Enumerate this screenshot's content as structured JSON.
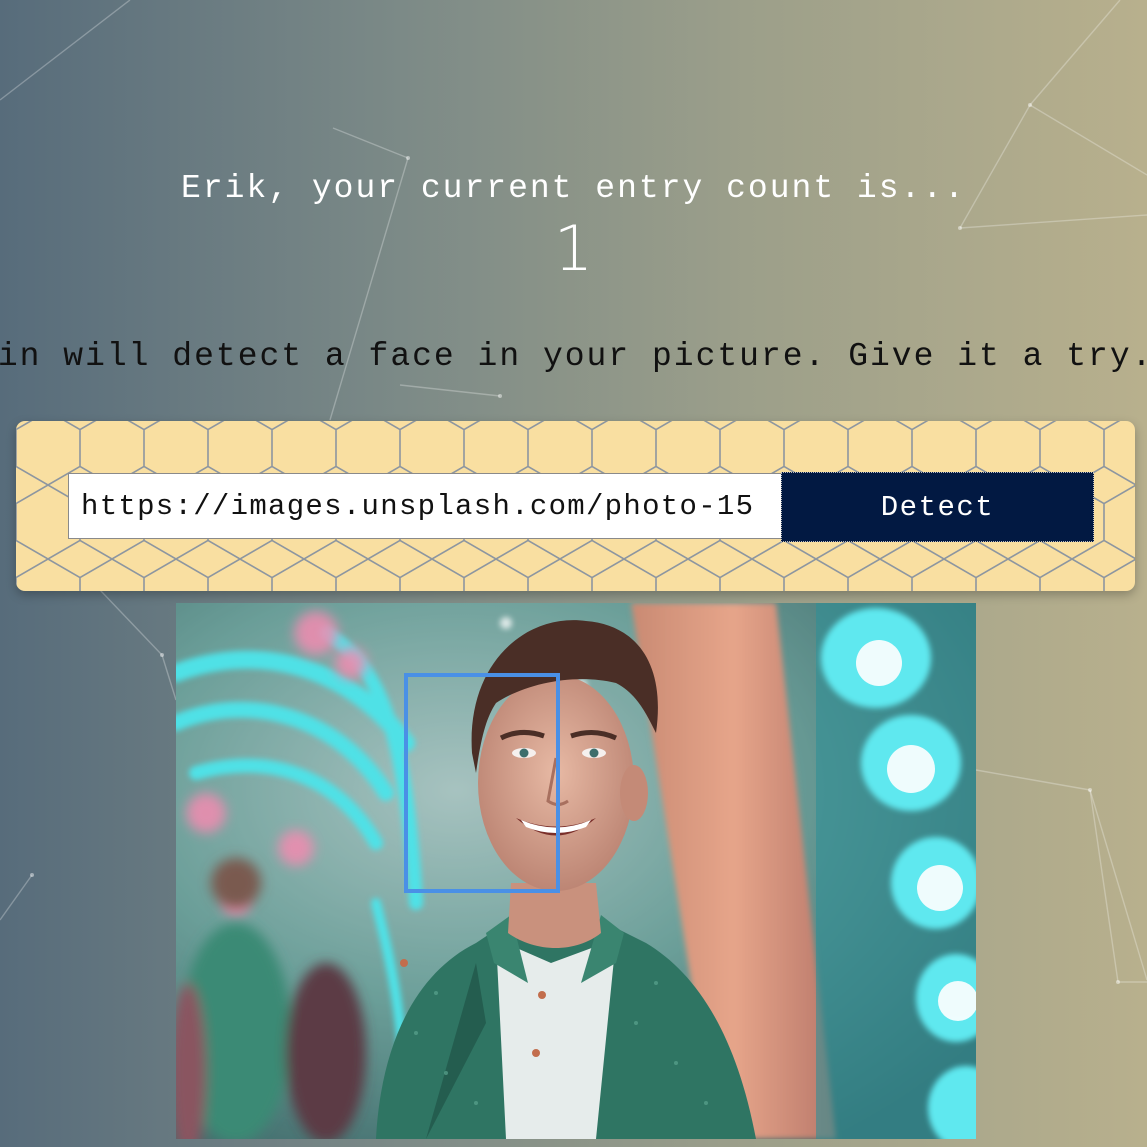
{
  "rank": {
    "message": "Erik, your current entry count is...",
    "count": "1"
  },
  "intro": {
    "text": "This Magic Brain will detect a face in your picture. Give it a try."
  },
  "form": {
    "url_value": "https://images.unsplash.com/photo-15",
    "detect_label": "Detect"
  },
  "face_detection": {
    "faces_detected": 1,
    "box_color": "#4a90e6"
  },
  "colors": {
    "button_bg": "#021942",
    "panel_bg": "#f9dfa1",
    "gradient_left": "#576c7b",
    "gradient_right": "#b8b08d"
  }
}
